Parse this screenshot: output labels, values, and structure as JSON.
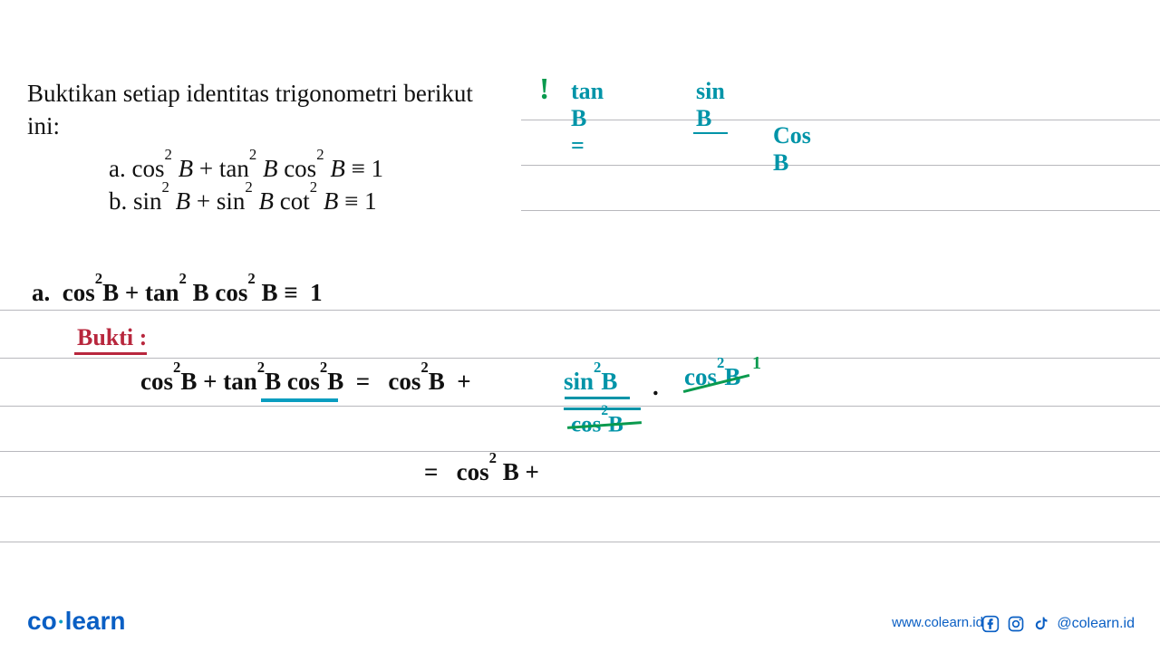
{
  "problem": {
    "title_line1": "Buktikan setiap identitas trigonometri berikut",
    "title_line2": "ini:",
    "item_a_prefix": "a.   ",
    "item_a": "cos² B + tan² B cos² B ≡ 1",
    "item_b_prefix": "b.   ",
    "item_b": "sin² B + sin² B cot² B ≡ 1"
  },
  "hint": {
    "mark": "!",
    "lhs": "tan  B  = ",
    "num": "sin B",
    "den": "Cos B"
  },
  "work": {
    "a_restate": "a.   cos²B + tan² B cos² B ≡  1",
    "bukti": "Bukti :",
    "step1_left": "cos²B + tan²B cos²B  =   cos²B  + ",
    "step1_sin": "sin²B",
    "step1_dot": ".",
    "step1_cos_right": "cos²B",
    "step1_one": "1",
    "step1_cos_den": "cos²B",
    "step2": "=    cos² B +"
  },
  "footer": {
    "logo_co": "co",
    "logo_learn": "learn",
    "url": "www.colearn.id",
    "handle": "@colearn.id"
  }
}
